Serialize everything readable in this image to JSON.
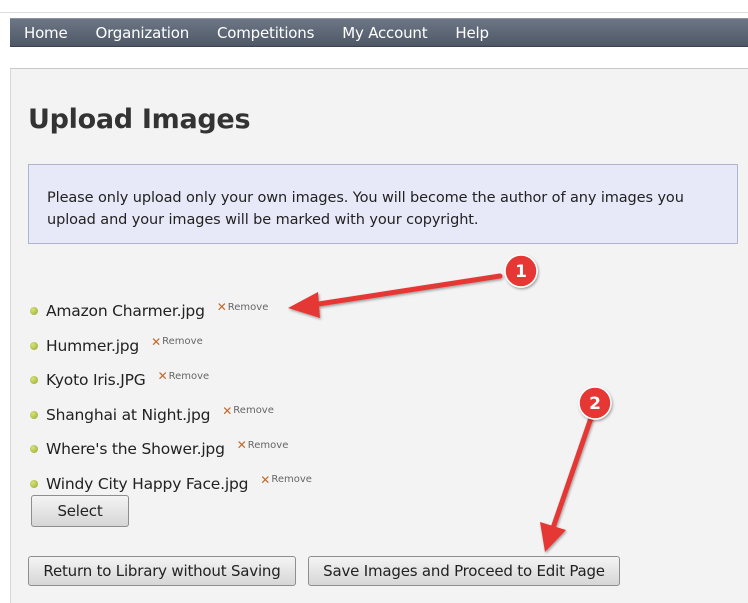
{
  "nav": {
    "items": [
      {
        "label": "Home"
      },
      {
        "label": "Organization"
      },
      {
        "label": "Competitions"
      },
      {
        "label": "My Account"
      },
      {
        "label": "Help"
      }
    ]
  },
  "page": {
    "title": "Upload Images",
    "notice": "Please only upload only your own images. You will become the author of any images you upload and your images will be marked with your copyright."
  },
  "files": [
    {
      "name": "Amazon Charmer.jpg",
      "remove_label": "Remove"
    },
    {
      "name": "Hummer.jpg",
      "remove_label": "Remove"
    },
    {
      "name": "Kyoto Iris.JPG",
      "remove_label": "Remove"
    },
    {
      "name": "Shanghai at Night.jpg",
      "remove_label": "Remove"
    },
    {
      "name": "Where's the Shower.jpg",
      "remove_label": "Remove"
    },
    {
      "name": "Windy City Happy Face.jpg",
      "remove_label": "Remove"
    }
  ],
  "buttons": {
    "select": "Select",
    "return": "Return to Library without Saving",
    "save": "Save Images and Proceed to Edit Page"
  },
  "annotations": {
    "badge1": "1",
    "badge2": "2",
    "color": "#e53935"
  },
  "icons": {
    "remove": "close-icon",
    "bullet": "bullet-dot"
  }
}
